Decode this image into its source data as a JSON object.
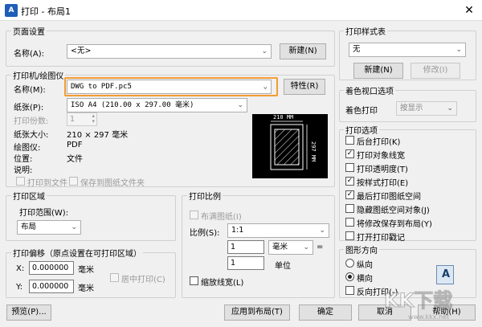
{
  "window": {
    "icon_text": "A",
    "title": "打印 - 布局1",
    "close_glyph": "✕"
  },
  "page_setup": {
    "group": "页面设置",
    "name_label": "名称(A):",
    "name_value": "<无>",
    "new_button": "新建(N)"
  },
  "printer": {
    "group": "打印机/绘图仪",
    "name_label": "名称(M):",
    "name_value": "DWG to PDF.pc5",
    "properties_button": "特性(R)",
    "paper_label": "纸张(P):",
    "paper_value": "ISO A4 (210.00 x 297.00 毫米)",
    "copies_label": "打印份数:",
    "copies_value": "1",
    "paper_size_label": "纸张大小:",
    "paper_size_value": "210 × 297  毫米",
    "plotter_label": "绘图仪:",
    "plotter_value": "PDF",
    "location_label": "位置:",
    "location_value": "文件",
    "desc_label": "说明:",
    "print_to_file": "打印到文件",
    "save_to_folder": "保存到图纸文件夹",
    "preview_width": "210 MM",
    "preview_height": "297 MM"
  },
  "print_area": {
    "group": "打印区域",
    "range_label": "打印范围(W):",
    "range_value": "布局"
  },
  "print_scale": {
    "group": "打印比例",
    "fit_paper": "布满图纸(I)",
    "scale_label": "比例(S):",
    "scale_value": "1:1",
    "value1": "1",
    "unit_value": "毫米",
    "equals": "=",
    "value2": "1",
    "unit_label": "单位",
    "scale_lineweights": "缩放线宽(L)"
  },
  "print_offset": {
    "group": "打印偏移（原点设置在可打印区域）",
    "x_label": "X:",
    "x_value": "0.000000",
    "x_unit": "毫米",
    "y_label": "Y:",
    "y_value": "0.000000",
    "y_unit": "毫米",
    "center": "居中打印(C)"
  },
  "style_table": {
    "group": "打印样式表",
    "value": "无",
    "new_button": "新建(N)",
    "edit_button": "修改(I)"
  },
  "shaded": {
    "group": "着色视口选项",
    "shade_label": "着色打印",
    "shade_value": "按显示"
  },
  "options": {
    "group": "打印选项",
    "items": [
      {
        "label": "后台打印(K)",
        "checked": false
      },
      {
        "label": "打印对象线宽",
        "checked": true
      },
      {
        "label": "打印透明度(T)",
        "checked": false
      },
      {
        "label": "按样式打印(E)",
        "checked": true
      },
      {
        "label": "最后打印图纸空间",
        "checked": true
      },
      {
        "label": "隐藏图纸空间对象(J)",
        "checked": false
      },
      {
        "label": "将修改保存到布局(Y)",
        "checked": false
      },
      {
        "label": "打开打印戳记",
        "checked": false
      }
    ]
  },
  "orientation": {
    "group": "图形方向",
    "portrait": "纵向",
    "landscape": "横向",
    "upside_down": "反向打印(-)",
    "letter": "A"
  },
  "footer": {
    "preview": "预览(P)...",
    "apply": "应用到布局(T)",
    "ok": "确定",
    "cancel": "取消",
    "help": "帮助(H)"
  },
  "watermark": {
    "text": "KK下载",
    "url": "www.kkx.net"
  }
}
